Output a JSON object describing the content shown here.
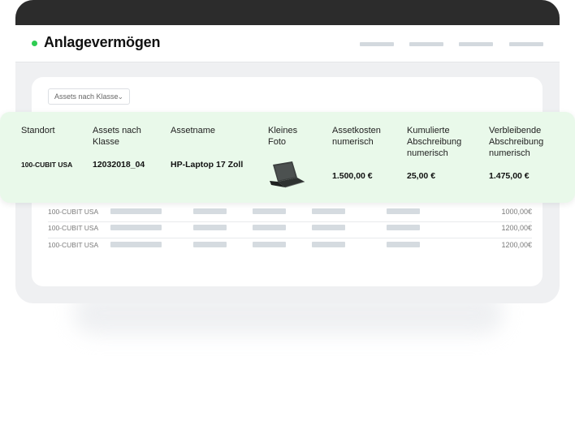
{
  "header": {
    "title": "Anlagevermögen",
    "status_color": "#2ecc52"
  },
  "filter": {
    "label": "Assets nach Klasse",
    "chevron_icon": "chevron-down-icon"
  },
  "columns": [
    {
      "key": "standort",
      "label": "Standort"
    },
    {
      "key": "klasse",
      "label": "Assets nach\nKlasse"
    },
    {
      "key": "name",
      "label": "Assetname"
    },
    {
      "key": "foto",
      "label": "Kleines\nFoto"
    },
    {
      "key": "kosten",
      "label": "Assetkosten\nnumerisch"
    },
    {
      "key": "kumuliert",
      "label": "Kumulierte\nAbschreibung\nnumerisch"
    },
    {
      "key": "verbleibend",
      "label": "Verbleibende\nAbschreibung\nnumerisch"
    }
  ],
  "highlight_row": {
    "standort": "100-CUBIT USA",
    "klasse": "12032018_04",
    "name": "HP-Laptop 17 Zoll",
    "foto_icon": "laptop-icon",
    "kosten": "1.500,00 €",
    "kumuliert": "25,00 €",
    "verbleibend": "1.475,00 €"
  },
  "rows": [
    {
      "standort": "100-CUBIT USA",
      "amount": "1000,00€"
    },
    {
      "standort": "100-CUBIT USA",
      "amount": "1200,00€"
    },
    {
      "standort": "100-CUBIT USA",
      "amount": "1200,00€"
    }
  ],
  "colors": {
    "accent": "#2ecc52",
    "highlight_bg": "#e9f9ea",
    "titlebar": "#2c2c2c"
  }
}
